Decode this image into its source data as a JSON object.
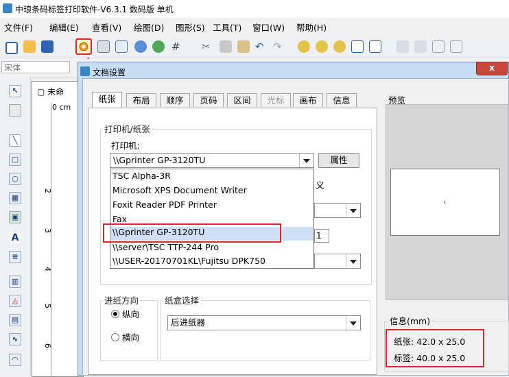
{
  "window": {
    "title": "中琅条码标签打印软件-V6.3.1 数码版 单机"
  },
  "menu": [
    "文件(F)",
    "编辑(E)",
    "查看(V)",
    "绘图(D)",
    "图形(S)",
    "工具(T)",
    "窗口(W)",
    "帮助(H)"
  ],
  "fontbar": {
    "font": "宋体"
  },
  "document": {
    "tab": "未命",
    "ruler_top": "0 cm",
    "ruler_marks": [
      "2",
      "3",
      "4",
      "5",
      "6"
    ]
  },
  "dialog": {
    "title": "文档设置",
    "close": "x",
    "tabs": [
      "纸张",
      "布局",
      "顺序",
      "页码",
      "区间",
      "光标",
      "画布",
      "信息"
    ],
    "printer_group": "打印机/纸张",
    "printer_label": "打印机:",
    "printer_selected": "\\\\Gprinter GP-3120TU",
    "properties_button": "属性",
    "hidden_text": "义",
    "spinner_value": "1",
    "printer_options": [
      "TSC Alpha-3R",
      "Microsoft XPS Document Writer",
      "Foxit Reader PDF Printer",
      "Fax",
      "\\\\Gprinter GP-3120TU",
      "\\\\server\\TSC TTP-244 Pro",
      "\\\\USER-20170701KL\\Fujitsu DPK750"
    ],
    "feed_group": "进纸方向",
    "portrait": "纵向",
    "landscape": "横向",
    "tray_group": "纸盒选择",
    "tray_selected": "后进纸器",
    "preview_title": "预览",
    "info_title": "信息(mm)",
    "paper_info": "纸张: 42.0 x 25.0",
    "label_info": "标签: 40.0 x 25.0"
  },
  "colors": {
    "highlight": "#e0262d",
    "annotation_arrow": "#d633d6"
  }
}
